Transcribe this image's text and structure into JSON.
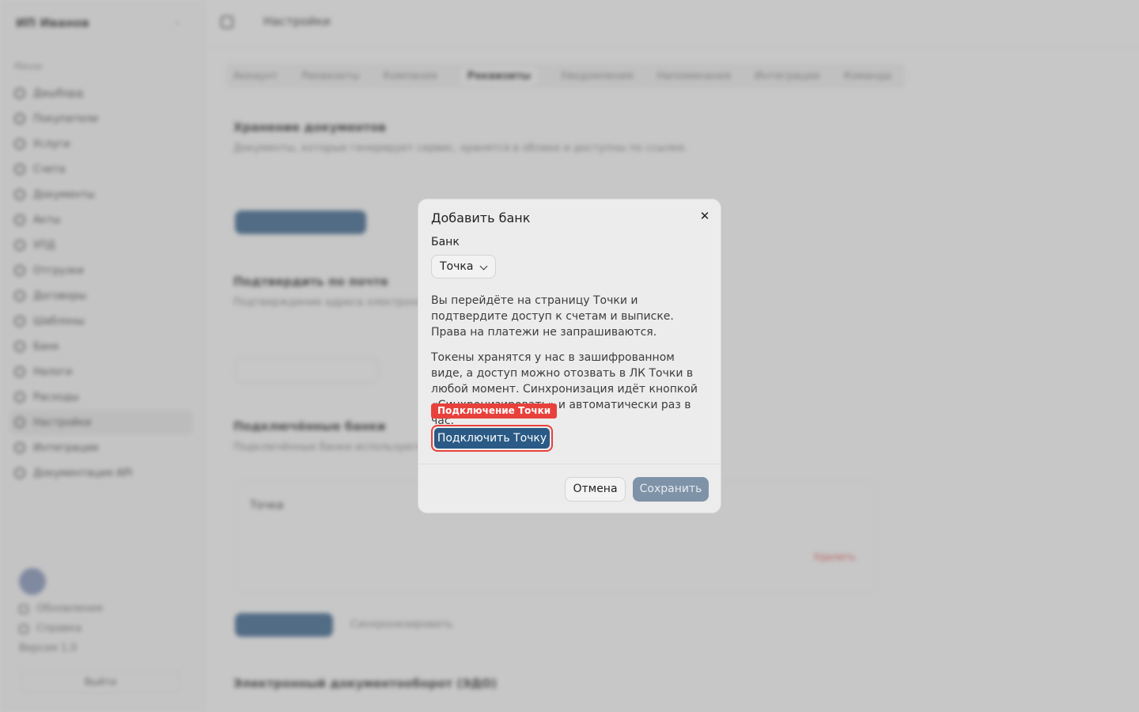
{
  "sidebar": {
    "brand": "ИП Иванов",
    "menu_title": "Меню",
    "items": [
      {
        "label": "Дашборд"
      },
      {
        "label": "Покупатели"
      },
      {
        "label": "Услуги"
      },
      {
        "label": "Счета"
      },
      {
        "label": "Документы"
      },
      {
        "label": "Акты"
      },
      {
        "label": "УПД"
      },
      {
        "label": "Отгрузки"
      },
      {
        "label": "Договоры"
      },
      {
        "label": "Шаблоны"
      },
      {
        "label": "Банк"
      },
      {
        "label": "Налоги"
      },
      {
        "label": "Расходы"
      },
      {
        "label": "Настройки"
      },
      {
        "label": "Интеграции"
      },
      {
        "label": "Документация API"
      }
    ],
    "bottom": {
      "link1": "Обновления",
      "link2": "Справка",
      "version": "Версия 1.0",
      "logout": "Выйти"
    }
  },
  "topbar": {
    "title": "Настройки"
  },
  "tabs": [
    "Аккаунт",
    "Реквизиты",
    "Компания",
    "Реквизиты",
    "Уведомления",
    "Напоминания",
    "Интеграции",
    "Команда"
  ],
  "background": {
    "sec1_title": "Хранение документов",
    "sec1_text": "Документы, которые генерирует сервис, хранятся в облаке и доступны по ссылке.",
    "sec2_title": "Подтвердить по почте",
    "sec2_text": "Подтверждение адреса электронной почты для отправки документов.",
    "sec3_title": "Подключённые банки",
    "sec3_text": "Подключённые банки используются для синхронизации выписок.",
    "card_title": "Точка",
    "sync_link": "Синхронизировать",
    "remove": "Удалить",
    "sec4_title": "Электронный документооборот (ЭДО)"
  },
  "modal": {
    "title": "Добавить банк",
    "bank_label": "Банк",
    "bank_selected": "Точка",
    "para1": "Вы перейдёте на страницу Точки и подтвердите доступ к счетам и выписке. Права на платежи не запрашиваются.",
    "para2": "Токены хранятся у нас в зашифрованном виде, а доступ можно отозвать в ЛК Точки в любой момент. Синхронизация идёт кнопкой «Синхронизировать» и автоматически раз в час.",
    "annotation": "Подключение Точки",
    "connect_label": "Подключить Точку",
    "cancel_label": "Отмена",
    "save_label": "Сохранить"
  },
  "colors": {
    "primary": "#2a5a85",
    "annotation": "#e8413c",
    "save_disabled": "#7f93a8"
  }
}
